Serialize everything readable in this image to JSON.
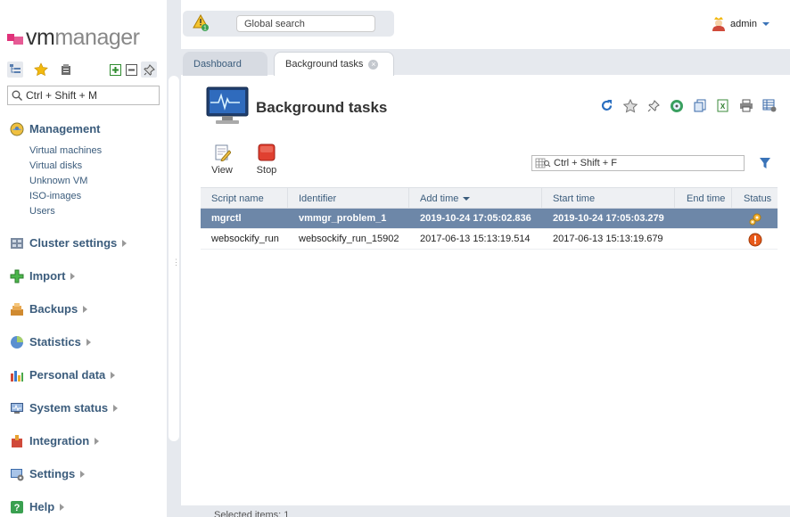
{
  "logo": {
    "prefix": "vm",
    "suffix": "manager"
  },
  "sidebar": {
    "search_placeholder": "Ctrl + Shift + M",
    "groups": [
      {
        "label": "Management",
        "icon": "management-icon",
        "expanded": true,
        "items": [
          "Virtual machines",
          "Virtual disks",
          "Unknown VM",
          "ISO-images",
          "Users"
        ]
      },
      {
        "label": "Cluster settings",
        "icon": "cluster-settings-icon"
      },
      {
        "label": "Import",
        "icon": "import-plus-icon"
      },
      {
        "label": "Backups",
        "icon": "backups-icon"
      },
      {
        "label": "Statistics",
        "icon": "statistics-icon"
      },
      {
        "label": "Personal data",
        "icon": "personal-data-icon"
      },
      {
        "label": "System status",
        "icon": "system-status-icon"
      },
      {
        "label": "Integration",
        "icon": "integration-icon"
      },
      {
        "label": "Settings",
        "icon": "settings-icon"
      },
      {
        "label": "Help",
        "icon": "help-icon"
      }
    ]
  },
  "header": {
    "notification_count": "1",
    "global_search_placeholder": "Global search",
    "user": "admin"
  },
  "tabs": [
    {
      "label": "Dashboard",
      "active": false
    },
    {
      "label": "Background tasks",
      "active": true
    }
  ],
  "page": {
    "title": "Background tasks",
    "actions": [
      {
        "label": "View",
        "icon": "view-edit-icon"
      },
      {
        "label": "Stop",
        "icon": "stop-icon"
      }
    ],
    "filter_placeholder": "Ctrl + Shift + F"
  },
  "table": {
    "columns": [
      "Script name",
      "Identifier",
      "Add time",
      "Start time",
      "End time",
      "Status"
    ],
    "sorted_column": "Add time",
    "rows": [
      {
        "script": "mgrctl",
        "identifier": "vmmgr_problem_1",
        "add_time": "2019-10-24 17:05:02.836",
        "start_time": "2019-10-24 17:05:03.279",
        "end_time": "",
        "status": "running",
        "selected": true
      },
      {
        "script": "websockify_run",
        "identifier": "websockify_run_15902",
        "add_time": "2017-06-13 15:13:19.514",
        "start_time": "2017-06-13 15:13:19.679",
        "end_time": "",
        "status": "error",
        "selected": false
      }
    ]
  },
  "footer": {
    "text": "Selected items: 1"
  },
  "colors": {
    "accent": "#3a73b8",
    "selected_row": "#6d87a8",
    "brand": "#e0327a"
  }
}
